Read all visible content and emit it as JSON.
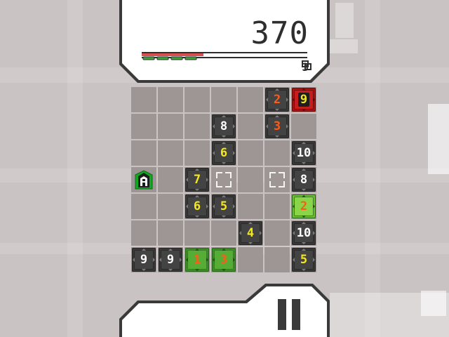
{
  "hud": {
    "score": "370",
    "moves_left": "3",
    "moves_icon": "copy-squares-icon",
    "progress_segments": 4
  },
  "board": {
    "rows": 7,
    "cols": 7,
    "tiles": [
      {
        "row": 0,
        "col": 5,
        "text": "2",
        "color": "orange",
        "style": "dark"
      },
      {
        "row": 0,
        "col": 6,
        "text": "9",
        "color": "yellow",
        "style": "red"
      },
      {
        "row": 1,
        "col": 3,
        "text": "8",
        "color": "white",
        "style": "dark"
      },
      {
        "row": 1,
        "col": 5,
        "text": "3",
        "color": "orange",
        "style": "dark"
      },
      {
        "row": 2,
        "col": 3,
        "text": "6",
        "color": "yellow",
        "style": "dark"
      },
      {
        "row": 2,
        "col": 6,
        "text": "10",
        "color": "white",
        "style": "dark"
      },
      {
        "row": 3,
        "col": 2,
        "text": "7",
        "color": "yellow",
        "style": "dark"
      },
      {
        "row": 3,
        "col": 6,
        "text": "8",
        "color": "white",
        "style": "dark"
      },
      {
        "row": 4,
        "col": 2,
        "text": "6",
        "color": "yellow",
        "style": "dark"
      },
      {
        "row": 4,
        "col": 3,
        "text": "5",
        "color": "yellow",
        "style": "dark"
      },
      {
        "row": 4,
        "col": 6,
        "text": "2",
        "color": "orange",
        "style": "lime"
      },
      {
        "row": 5,
        "col": 4,
        "text": "4",
        "color": "yellow",
        "style": "dark"
      },
      {
        "row": 5,
        "col": 6,
        "text": "10",
        "color": "white",
        "style": "dark"
      },
      {
        "row": 6,
        "col": 0,
        "text": "9",
        "color": "white",
        "style": "dark"
      },
      {
        "row": 6,
        "col": 1,
        "text": "9",
        "color": "white",
        "style": "dark"
      },
      {
        "row": 6,
        "col": 2,
        "text": "1",
        "color": "orange",
        "style": "green"
      },
      {
        "row": 6,
        "col": 3,
        "text": "3",
        "color": "orange",
        "style": "green"
      },
      {
        "row": 6,
        "col": 6,
        "text": "5",
        "color": "yellow",
        "style": "dark"
      }
    ],
    "targets": [
      {
        "row": 3,
        "col": 3
      },
      {
        "row": 3,
        "col": 5
      }
    ],
    "player": {
      "row": 3,
      "col": 0,
      "icon": "player-marker-icon"
    }
  },
  "colors": {
    "background": "#c9c3c3",
    "cell": "#9e9595",
    "tile_dark": "#383838",
    "tile_green": "#56ad36",
    "tile_red": "#c41e1e",
    "num_white": "#ffffff",
    "num_yellow": "#f4e81c",
    "num_orange": "#ff5a16",
    "accent_red": "#d65050",
    "accent_green": "#3fa33a"
  },
  "controls": {
    "pause_icon": "pause-icon"
  }
}
